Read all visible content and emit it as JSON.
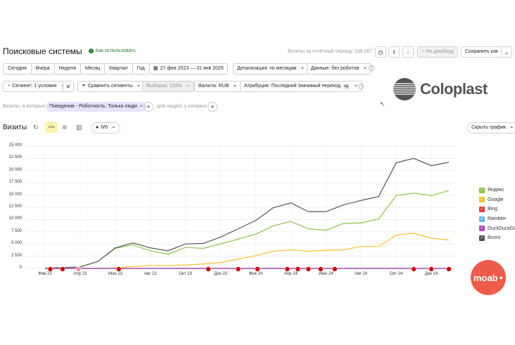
{
  "header": {
    "title": "Поисковые системы",
    "how_to_use": "Как использовать",
    "visits_label": "Визиты за отчётный период: 238 267",
    "to_dashboard": "+ На дашборд",
    "save_as": "Сохранить как"
  },
  "periods": [
    "Сегодня",
    "Вчера",
    "Неделя",
    "Месяц",
    "Квартал",
    "Год"
  ],
  "toolbar": {
    "date_range": "27 фев 2023 — 31 янв 2025",
    "detail": "Детализация: по месяцам",
    "data": "Данные: без роботов",
    "segment": "Сегмент: 1 условие",
    "compare": "Сравнить сегменты",
    "sample": "Выборка: 100%",
    "currency": "Валюта: RUB",
    "attribution": "Атрибуция: Последний значимый переход",
    "attribution_badge": "кд"
  },
  "filters": {
    "prefix": "Визиты, в которых",
    "chip": "Поведение - Роботность: Только люди",
    "suffix": "для людей, у которых"
  },
  "chart_header": {
    "title": "Визиты",
    "series_count": "6/6",
    "hide_chart": "Скрыть график"
  },
  "logos": {
    "coloplast": "Coloplast",
    "moab": "moab"
  },
  "colors": {
    "yandex": "#8bc34a",
    "google": "#fbc02d",
    "bing": "#e53935",
    "rambler": "#64b5f6",
    "duckduckgo": "#ab47bc",
    "total": "#555555",
    "accent_green": "#2e7d32"
  },
  "chart_data": {
    "type": "line",
    "yticks": [
      "0",
      "2 500",
      "5 000",
      "7 500",
      "10 000",
      "12 500",
      "15 000",
      "17 500",
      "20 000",
      "22 500",
      "25 000"
    ],
    "ylim": [
      0,
      25000
    ],
    "xticks": [
      "Фев 23",
      "Апр 23",
      "Июн 23",
      "Авг 23",
      "Окт 23",
      "Дек 23",
      "Фев 24",
      "Апр 24",
      "Июн 24",
      "Авг 24",
      "Окт 24",
      "Дек 24"
    ],
    "x": [
      "Фев 23",
      "Мар 23",
      "Апр 23",
      "Май 23",
      "Июн 23",
      "Июл 23",
      "Авг 23",
      "Сен 23",
      "Окт 23",
      "Ноя 23",
      "Дек 23",
      "Янв 24",
      "Фев 24",
      "Мар 24",
      "Апр 24",
      "Май 24",
      "Июн 24",
      "Июл 24",
      "Авг 24",
      "Сен 24",
      "Окт 24",
      "Ноя 24",
      "Дек 24",
      "Янв 25"
    ],
    "series": [
      {
        "name": "Яндекс",
        "color": "#8bc34a",
        "values": [
          0,
          150,
          300,
          1400,
          4100,
          4800,
          3600,
          2900,
          4300,
          4100,
          5000,
          6000,
          7000,
          8700,
          9600,
          8100,
          7800,
          9200,
          9300,
          10100,
          14900,
          15400,
          14900,
          15900
        ]
      },
      {
        "name": "Google",
        "color": "#fbc02d",
        "values": [
          0,
          0,
          0,
          0,
          100,
          400,
          600,
          600,
          700,
          900,
          1200,
          1900,
          2600,
          3500,
          3800,
          3500,
          3700,
          3800,
          4500,
          4500,
          6800,
          7200,
          6200,
          5800
        ]
      },
      {
        "name": "Bing",
        "color": "#e53935",
        "values": [
          0,
          0,
          0,
          0,
          0,
          0,
          0,
          0,
          0,
          0,
          0,
          0,
          0,
          0,
          0,
          0,
          0,
          0,
          0,
          0,
          0,
          0,
          0,
          0
        ]
      },
      {
        "name": "Rambler",
        "color": "#64b5f6",
        "values": [
          0,
          0,
          0,
          0,
          0,
          0,
          0,
          0,
          0,
          0,
          0,
          0,
          0,
          0,
          0,
          0,
          0,
          0,
          0,
          0,
          0,
          0,
          0,
          0
        ]
      },
      {
        "name": "DuckDuckGo",
        "color": "#ab47bc",
        "values": [
          0,
          0,
          0,
          0,
          0,
          0,
          0,
          0,
          0,
          0,
          0,
          0,
          0,
          0,
          0,
          0,
          0,
          0,
          0,
          0,
          0,
          0,
          0,
          0
        ]
      },
      {
        "name": "Всего",
        "color": "#555555",
        "values": [
          0,
          150,
          300,
          1400,
          4200,
          5200,
          4200,
          3600,
          5000,
          5100,
          6400,
          8100,
          9800,
          12400,
          13400,
          11600,
          11600,
          13000,
          13900,
          14700,
          21600,
          22500,
          21000,
          21700
        ]
      }
    ],
    "annotations_x": [
      0.3,
      1.0,
      1.9,
      4.2,
      9.3,
      11.0,
      12.1,
      13.8,
      14.4,
      15.0,
      15.7,
      16.5,
      21.0,
      22.0,
      23.0
    ],
    "legend_position": "right",
    "grid": true
  }
}
